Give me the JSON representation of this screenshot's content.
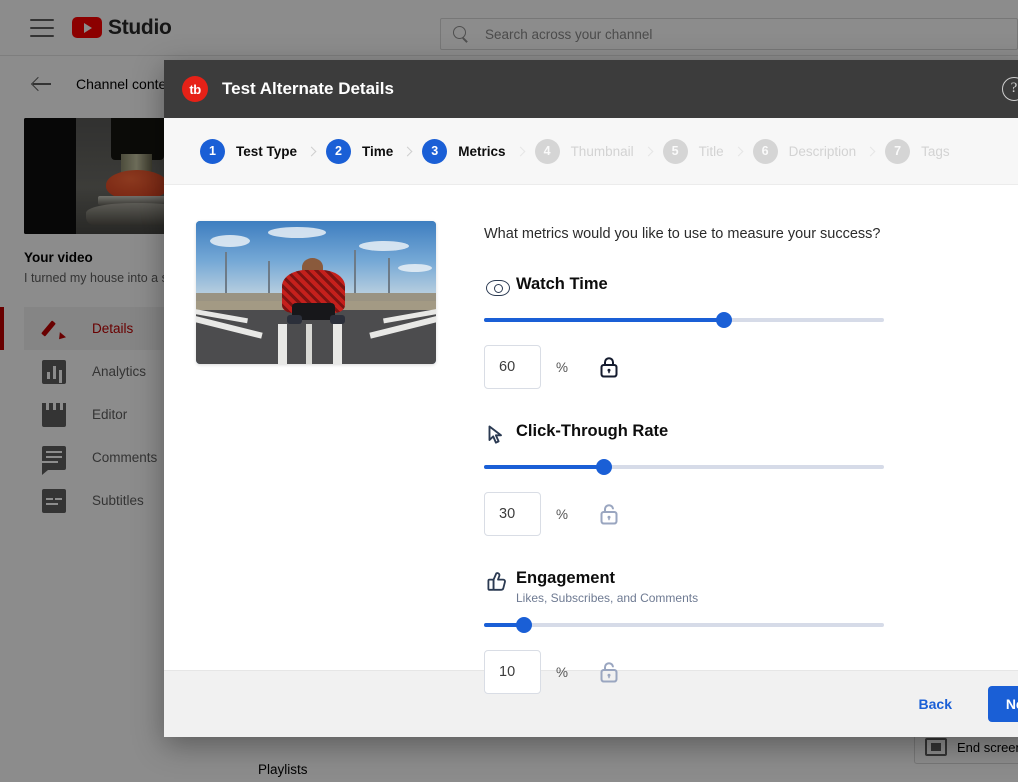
{
  "studio": {
    "brand_word": "Studio",
    "menu_icon": "hamburger-icon",
    "search": {
      "placeholder": "Search across your channel",
      "value": ""
    },
    "page_title": "Channel content",
    "video": {
      "heading": "Your video",
      "subtitle": "I turned my house into a se"
    },
    "rail_items": [
      {
        "label": "Details",
        "icon": "pencil-icon",
        "active": true
      },
      {
        "label": "Analytics",
        "icon": "bar-chart-icon",
        "active": false
      },
      {
        "label": "Editor",
        "icon": "clapper-icon",
        "active": false
      },
      {
        "label": "Comments",
        "icon": "comment-icon",
        "active": false
      },
      {
        "label": "Subtitles",
        "icon": "captions-icon",
        "active": false
      }
    ],
    "playlists_label": "Playlists",
    "end_screen_label": "End screen"
  },
  "modal": {
    "logo_text": "tb",
    "title": "Test Alternate Details",
    "help_icon": "help-circle-icon",
    "help_glyph": "?",
    "steps": [
      {
        "number": "1",
        "label": "Test Type",
        "state": "done"
      },
      {
        "number": "2",
        "label": "Time",
        "state": "done"
      },
      {
        "number": "3",
        "label": "Metrics",
        "state": "current"
      },
      {
        "number": "4",
        "label": "Thumbnail",
        "state": "inactive"
      },
      {
        "number": "5",
        "label": "Title",
        "state": "inactive"
      },
      {
        "number": "6",
        "label": "Description",
        "state": "inactive"
      },
      {
        "number": "7",
        "label": "Tags",
        "state": "inactive"
      }
    ],
    "question": "What metrics would you like to use to measure your success?",
    "metrics": [
      {
        "name": "Watch Time",
        "subtitle": "",
        "icon": "eye-icon",
        "value": "60",
        "percent_symbol": "%",
        "slider_percent": 60,
        "locked": true,
        "lock_icon": "lock-closed-icon"
      },
      {
        "name": "Click-Through Rate",
        "subtitle": "",
        "icon": "cursor-icon",
        "value": "30",
        "percent_symbol": "%",
        "slider_percent": 30,
        "locked": false,
        "lock_icon": "lock-open-icon"
      },
      {
        "name": "Engagement",
        "subtitle": "Likes, Subscribes, and Comments",
        "icon": "thumbs-up-icon",
        "value": "10",
        "percent_symbol": "%",
        "slider_percent": 10,
        "locked": false,
        "lock_icon": "lock-open-icon"
      }
    ],
    "footer": {
      "back_label": "Back",
      "next_label": "Next"
    }
  },
  "colors": {
    "accent_blue": "#1a5fd6",
    "brand_red": "#e62117",
    "header_dark": "#3c3c3c",
    "track_grey": "#d6dbe8",
    "active_rail_red": "#c00000"
  }
}
